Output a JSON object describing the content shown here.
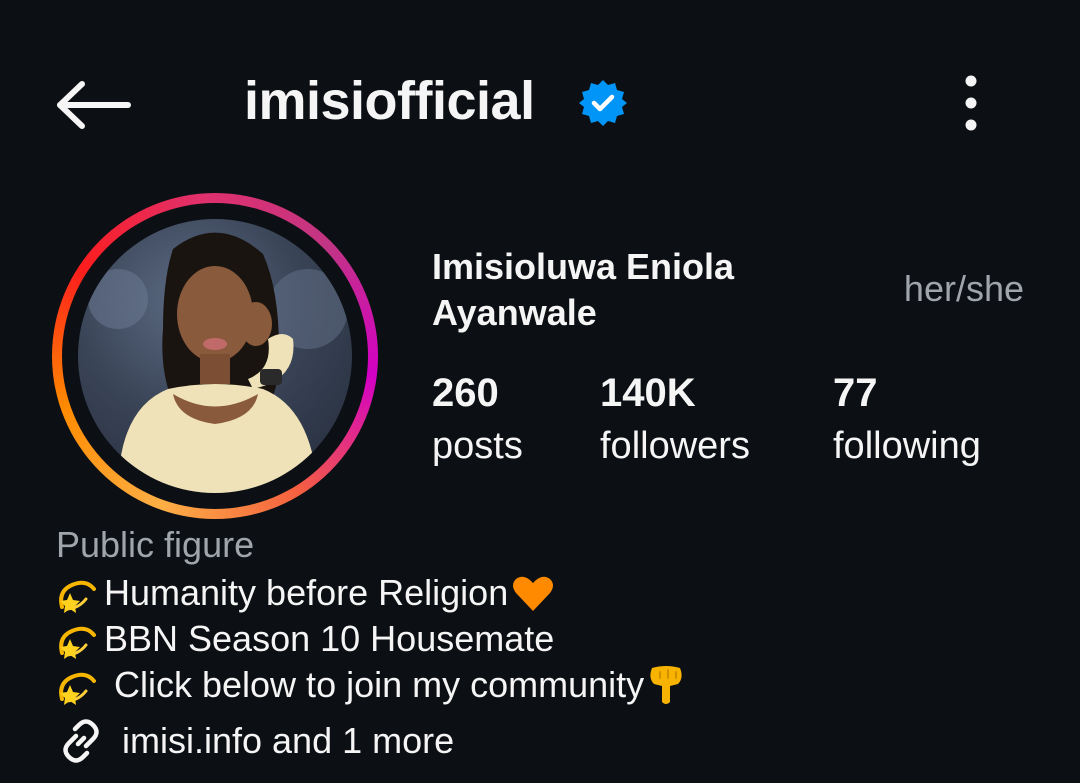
{
  "header": {
    "username": "imisiofficial",
    "verified": true,
    "back_icon": "arrow-left-icon",
    "more_icon": "more-vertical-icon"
  },
  "profile": {
    "full_name": "Imisioluwa Eniola Ayanwale",
    "pronouns": "her/she",
    "avatar_icon": "profile-photo"
  },
  "stats": [
    {
      "count": "260",
      "label": "posts"
    },
    {
      "count": "140K",
      "label": "followers"
    },
    {
      "count": "77",
      "label": "following"
    }
  ],
  "bio": {
    "category": "Public figure",
    "lines": [
      "Humanity before Religion",
      "BBN Season 10 Housemate",
      " Click below to join my community"
    ]
  },
  "link": {
    "text": "imisi.info and 1 more",
    "icon": "link-icon"
  },
  "colors": {
    "background": "#0c0f14",
    "text": "#f5f5f5",
    "secondary_text": "#a0a4ab",
    "verified_blue": "#0095f6"
  }
}
